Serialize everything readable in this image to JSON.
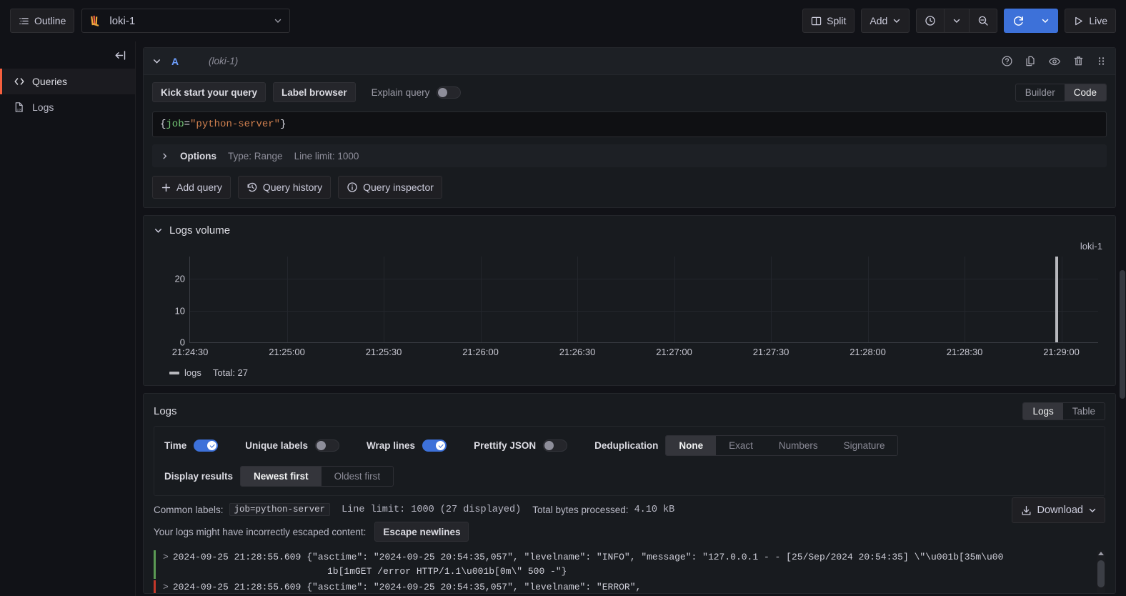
{
  "topbar": {
    "outline_label": "Outline",
    "datasource": "loki-1",
    "split_label": "Split",
    "add_label": "Add",
    "live_label": "Live",
    "icons": {
      "outline": "outline-list-icon",
      "datasource_logo": "loki-logo-icon",
      "datasource_chevron": "chevron-down-icon",
      "split": "split-panes-icon",
      "add_chevron": "chevron-down-icon",
      "time_picker": "clock-icon",
      "time_chevron": "chevron-down-icon",
      "zoom_out": "zoom-out-icon",
      "refresh": "refresh-icon",
      "refresh_chevron": "chevron-down-icon",
      "live": "play-icon"
    }
  },
  "sidebar": {
    "collapse_icon": "collapse-left-icon",
    "items": [
      {
        "label": "Queries",
        "icon": "code-brackets-icon",
        "active": true
      },
      {
        "label": "Logs",
        "icon": "log-document-icon",
        "active": false
      }
    ]
  },
  "query": {
    "ref_id": "A",
    "datasource_note": "(loki-1)",
    "collapse_icon": "chevron-down-icon",
    "header_icons": [
      {
        "name": "help-icon"
      },
      {
        "name": "duplicate-query-icon"
      },
      {
        "name": "toggle-visibility-eye-icon"
      },
      {
        "name": "delete-trash-icon"
      },
      {
        "name": "drag-handle-icon"
      }
    ],
    "kick_start_label": "Kick start your query",
    "label_browser_label": "Label browser",
    "explain_query_label": "Explain query",
    "explain_query_on": false,
    "mode_options": [
      "Builder",
      "Code"
    ],
    "mode_selected": "Code",
    "expression_tokens": [
      {
        "text": "{",
        "type": "brace"
      },
      {
        "text": "job",
        "type": "label"
      },
      {
        "text": "=",
        "type": "eq"
      },
      {
        "text": "\"python-server\"",
        "type": "str"
      },
      {
        "text": "}",
        "type": "brace"
      }
    ],
    "expression_plain": "{job=\"python-server\"}",
    "options": {
      "chevron": "chevron-right-icon",
      "label": "Options",
      "type_text": "Type: Range",
      "line_limit_text": "Line limit: 1000"
    },
    "actions": [
      {
        "label": "Add query",
        "icon": "plus-icon"
      },
      {
        "label": "Query history",
        "icon": "history-clock-icon"
      },
      {
        "label": "Query inspector",
        "icon": "info-circle-icon"
      }
    ]
  },
  "logs_volume": {
    "title": "Logs volume",
    "collapse_icon": "chevron-down-icon",
    "series_label": "loki-1",
    "legend": {
      "name": "logs",
      "total_label": "Total: 27"
    }
  },
  "chart_data": {
    "type": "bar",
    "title": "Logs volume",
    "xlabel": "",
    "ylabel": "",
    "ylim": [
      0,
      27
    ],
    "yticks": [
      0,
      10,
      20
    ],
    "grid": true,
    "legend_position": "bottom-left",
    "series_name": "loki-1",
    "xticks": [
      "21:24:30",
      "21:25:00",
      "21:25:30",
      "21:26:00",
      "21:26:30",
      "21:27:00",
      "21:27:30",
      "21:28:00",
      "21:28:30",
      "21:29:00"
    ],
    "bar_color": "#b7b8bd",
    "points": [
      {
        "x": "21:28:55",
        "y": 27
      }
    ],
    "total": 27
  },
  "logs": {
    "title": "Logs",
    "view_modes": [
      "Logs",
      "Table"
    ],
    "view_selected": "Logs",
    "toggles": [
      {
        "label": "Time",
        "on": true
      },
      {
        "label": "Unique labels",
        "on": false
      },
      {
        "label": "Wrap lines",
        "on": true
      },
      {
        "label": "Prettify JSON",
        "on": false
      }
    ],
    "dedup": {
      "label": "Deduplication",
      "options": [
        "None",
        "Exact",
        "Numbers",
        "Signature"
      ],
      "selected": "None"
    },
    "display_results": {
      "label": "Display results",
      "options": [
        "Newest first",
        "Oldest first"
      ],
      "selected": "Newest first"
    },
    "meta": {
      "common_labels_label": "Common labels:",
      "common_labels_value": "job=python-server",
      "line_limit_text": "Line limit: 1000 (27 displayed)",
      "bytes_label": "Total bytes processed:",
      "bytes_value": "4.10 kB",
      "escape_warning": "Your logs might have incorrectly escaped content:",
      "escape_button": "Escape newlines"
    },
    "download": {
      "label": "Download",
      "icon": "download-icon",
      "chevron": "chevron-down-icon"
    },
    "rows": [
      {
        "level_color": "#5b9a54",
        "expander": ">",
        "timestamp": "2024-09-25 21:28:55.609",
        "message_line1": "{\"asctime\": \"2024-09-25 20:54:35,057\", \"levelname\": \"INFO\", \"message\": \"127.0.0.1 - - [25/Sep/2024 20:54:35] \\\"\\u001b[35m\\u00",
        "message_line2": "1b[1mGET /error HTTP/1.1\\u001b[0m\\\" 500 -\"}"
      },
      {
        "level_color": "#c4372a",
        "expander": ">",
        "timestamp": "2024-09-25 21:28:55.609",
        "message_line1": "{\"asctime\": \"2024-09-25 20:54:35,057\", \"levelname\": \"ERROR\",",
        "message_line2": ""
      }
    ]
  }
}
